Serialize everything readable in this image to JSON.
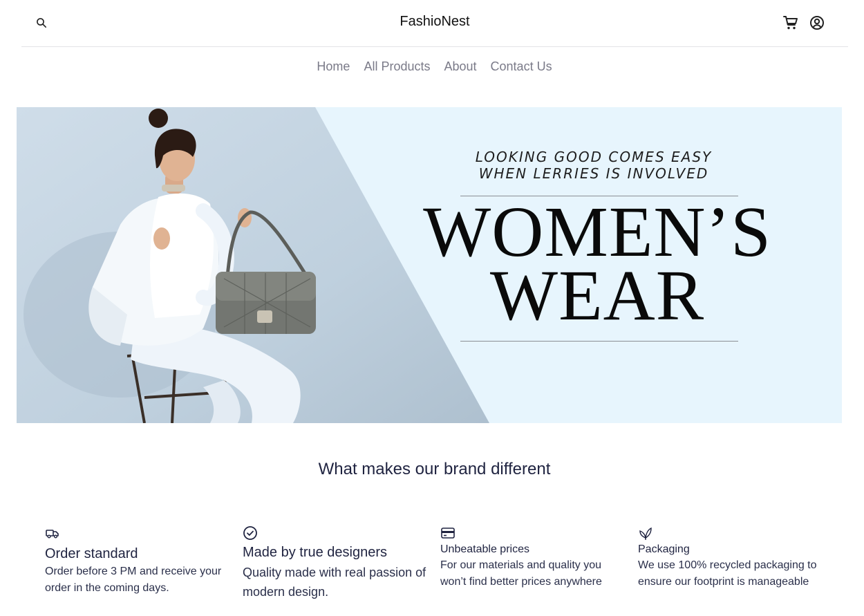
{
  "brand": {
    "name": "FashioNest"
  },
  "header": {
    "search_icon": "search-icon",
    "cart_icon": "cart-icon",
    "account_icon": "user-circle-icon"
  },
  "nav": {
    "items": [
      {
        "label": "Home"
      },
      {
        "label": "All Products"
      },
      {
        "label": "About"
      },
      {
        "label": "Contact Us"
      }
    ]
  },
  "hero": {
    "tagline_line1": "LOOKING GOOD COMES EASY",
    "tagline_line2": "WHEN LERRIES IS INVOLVED",
    "headline_line1": "WOMEN’S",
    "headline_line2": "WEAR",
    "image_alt": "woman in white outfit seated with grey quilted handbag"
  },
  "section": {
    "title": "What makes our brand different"
  },
  "features": [
    {
      "icon": "truck-icon",
      "title": "Order standard",
      "description": "Order before 3 PM and receive your order in the coming days."
    },
    {
      "icon": "check-circle-icon",
      "title": "Made by true designers",
      "description": "Quality made with real passion of modern design."
    },
    {
      "icon": "credit-card-icon",
      "title": "Unbeatable prices",
      "description": "For our materials and quality you won’t find better prices anywhere"
    },
    {
      "icon": "leaf-icon",
      "title": "Packaging",
      "description": "We use 100% recycled packaging to ensure our footprint is manageable"
    }
  ],
  "colors": {
    "text_primary": "#1f2340",
    "nav_text": "#7a7a88",
    "hero_bg": "#e7f5fd",
    "divider": "#e3e3e6"
  }
}
